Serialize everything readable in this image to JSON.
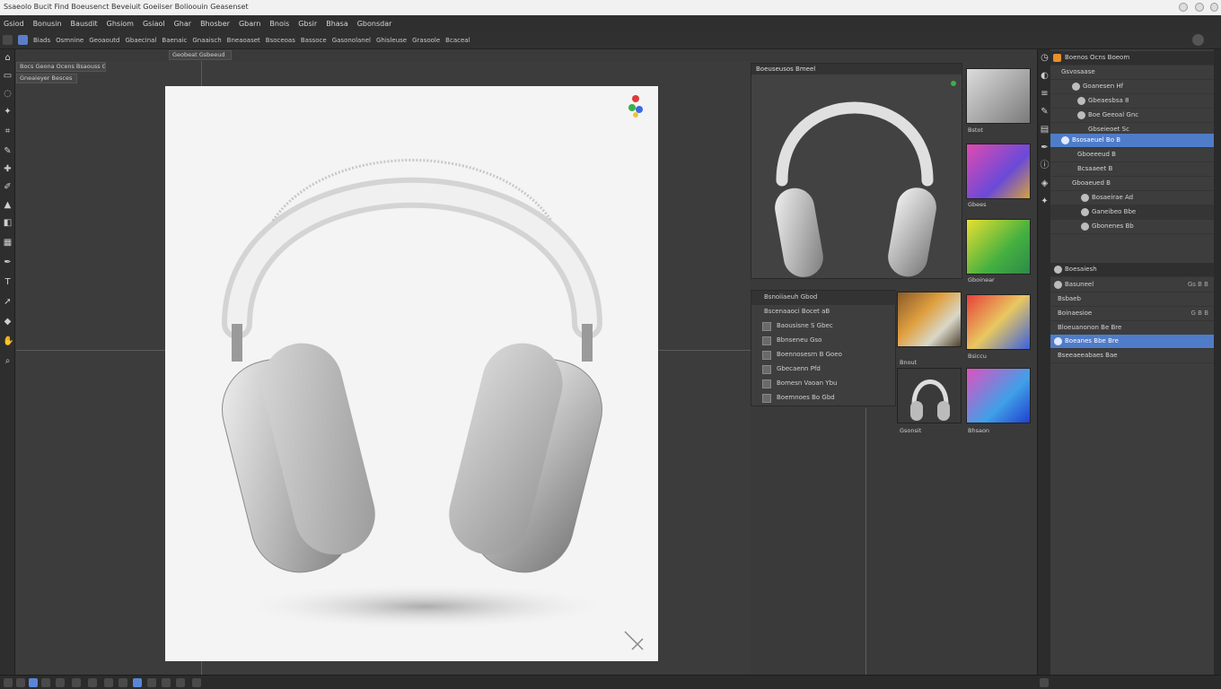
{
  "app": {
    "title": "Ssaeolo Bucit  Find  Boeusenct Beveiuit  Goeiiser  Bolioouin  Geasenset"
  },
  "menu": [
    "Gsiod",
    "Bonusin",
    "Bausdit",
    "Ghsiom",
    "Gsiaol",
    "Ghar",
    "Bhosber",
    "Gbarn",
    "Bnois",
    "Gbsir",
    "Bhasa",
    "Gbonsdar"
  ],
  "options": [
    "Biads",
    "Osmnine",
    "Geoaoutd",
    "Gbaecinal",
    "Baenaic",
    "Gnaaisch",
    "Bneaoaset",
    "Bsoceoas",
    "Bassoce",
    "Gasonolanel",
    "Ghisleuse",
    "Grasoole",
    "Bcaceal"
  ],
  "doc_tabs": [
    "Bocs Geona Ocens Bsaouss Gbase Gbs Ganenesd",
    "Gneaieyer Besces",
    "Geobeat Gsbeeud"
  ],
  "previews": {
    "title": "Boeuseusos Bmeel"
  },
  "swatches": [
    {
      "label": "Bstot",
      "colors": [
        "#d8d8d8",
        "#a8a8a8",
        "#6a6a6a"
      ]
    },
    {
      "label": "Gbees",
      "colors": [
        "#e04ab0",
        "#6a4ad8",
        "#d6a03e"
      ]
    },
    {
      "label": "Gboinear",
      "colors": [
        "#e8e030",
        "#44b040",
        "#2c8a4a"
      ]
    },
    {
      "label": "Bsiccu",
      "colors": [
        "#e8403a",
        "#3a60e0",
        "#e8c860"
      ]
    },
    {
      "label": "Gsonsit",
      "colors": [
        "#e8e8e8",
        "#a0a0a0",
        "#6c6c6c"
      ]
    },
    {
      "label": "Bhsaon",
      "colors": [
        "#e050c0",
        "#40a0e8",
        "#2040d0"
      ]
    }
  ],
  "gradient_swatch": {
    "label": "Bnout",
    "colors": [
      "#5a4a38",
      "#c07a2a",
      "#d8d0b0",
      "#604830"
    ]
  },
  "layers_sub": {
    "title": "Bsnoiiaeuh Gbod",
    "group": "Bscenaaoci Bocet aB",
    "items": [
      "Baousisne  S  Gbec",
      "Bbnseneu  Gso",
      "Boennosesrn  B  Goeo",
      "Gbecaenn Pfd",
      "Bomesn Vaoan Ybu",
      "Boemnoes  Bo  Gbd"
    ]
  },
  "right_panel": {
    "header": "Boenos Ocns  Boeom",
    "rows": [
      {
        "text": "Gsvosaase",
        "extra": ""
      },
      {
        "text": "Goanesen  Hf",
        "extra": ""
      },
      {
        "text": "Gbeaesbsa  8",
        "extra": ""
      },
      {
        "text": "Boe Geeoal  Gnc",
        "extra": ""
      },
      {
        "text": "Gbseieoet  Sc",
        "extra": ""
      },
      {
        "text": "Bsosaeuel  Bo  B",
        "extra": ""
      },
      {
        "text": "Gboeeeud  B",
        "extra": ""
      },
      {
        "text": "Bcsaaeet  B",
        "extra": ""
      },
      {
        "text": "Gboaeued  B",
        "extra": ""
      },
      {
        "text": "Bosaeirae  Ad",
        "extra": ""
      },
      {
        "text": "Ganeibeo  Bbe",
        "extra": ""
      },
      {
        "text": "Gbonenes  Bb",
        "extra": ""
      }
    ],
    "section2": "Boesaiesh",
    "rows2": [
      {
        "text": "Basuneel",
        "extra": "Gs  B  B"
      },
      {
        "text": "Bsbaeb",
        "extra": ""
      },
      {
        "text": "Boinaesioe",
        "extra": "G  B  B"
      },
      {
        "text": "Bloeuanonon  Be  Bre",
        "extra": ""
      },
      {
        "text": "Boeanes  Bbe  Bre",
        "extra": ""
      },
      {
        "text": "Bseeaeeabaes  Bae",
        "extra": ""
      }
    ]
  }
}
